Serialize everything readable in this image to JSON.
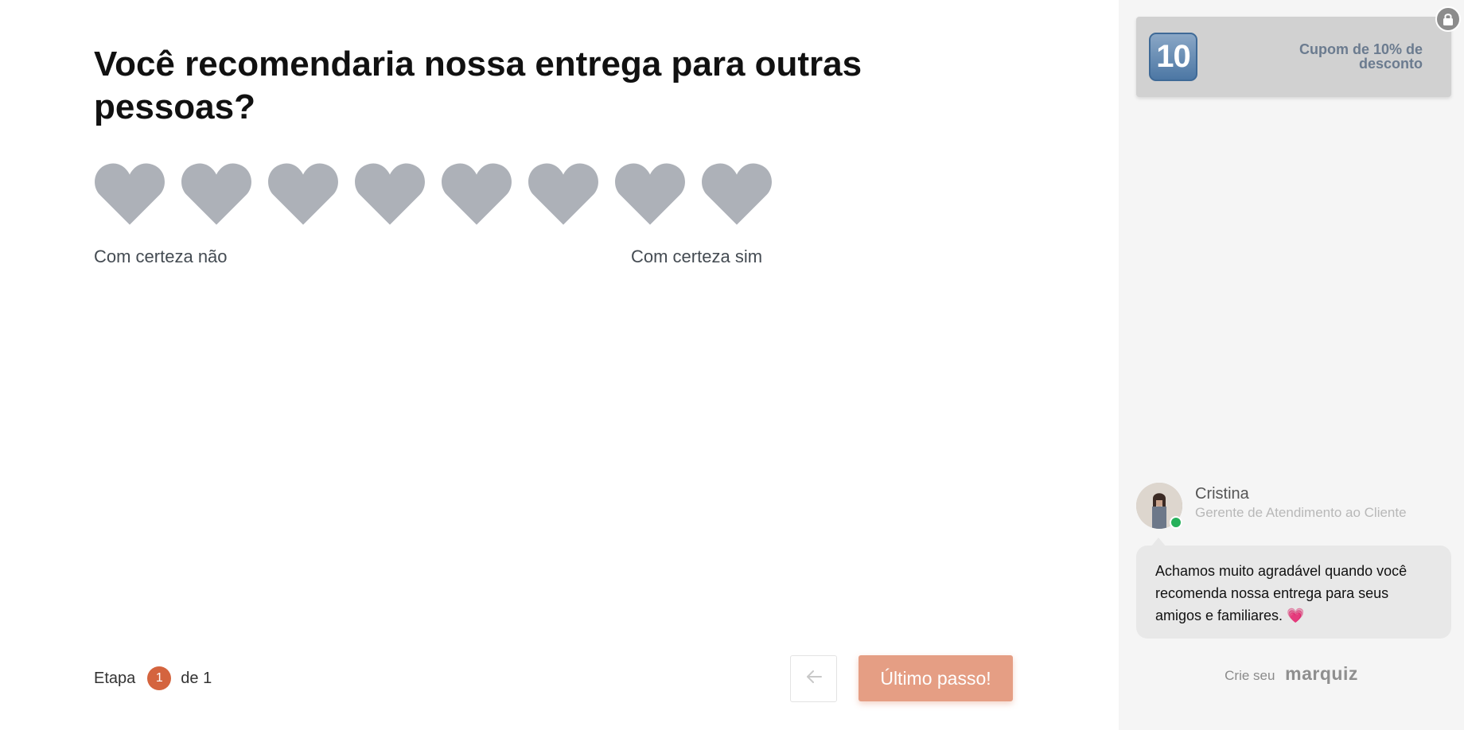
{
  "question": {
    "line1": "Você recomendaria nossa entrega para outras",
    "line2": "pessoas?"
  },
  "rating": {
    "count": 8,
    "heart_color": "#adb1b8",
    "label_low": "Com certeza não",
    "label_high": "Com certeza sim"
  },
  "footer": {
    "step_prefix": "Etapa",
    "step_current": "1",
    "step_suffix": "de 1",
    "next_label": "Último passo!",
    "back_icon": "arrow-left-icon"
  },
  "sidebar": {
    "coupon_emoji": "10",
    "coupon_text": "Cupom de 10% de desconto",
    "agent_name": "Cristina",
    "agent_role": "Gerente de Atendimento ao Cliente",
    "message": "Achamos muito agradável quando você recomenda nossa entrega para seus amigos e familiares. 💗",
    "brand_prefix": "Crie seu",
    "brand_name": "marquiz"
  },
  "colors": {
    "accent": "#d4643e",
    "button": "#e59e84",
    "online": "#27b15b"
  }
}
